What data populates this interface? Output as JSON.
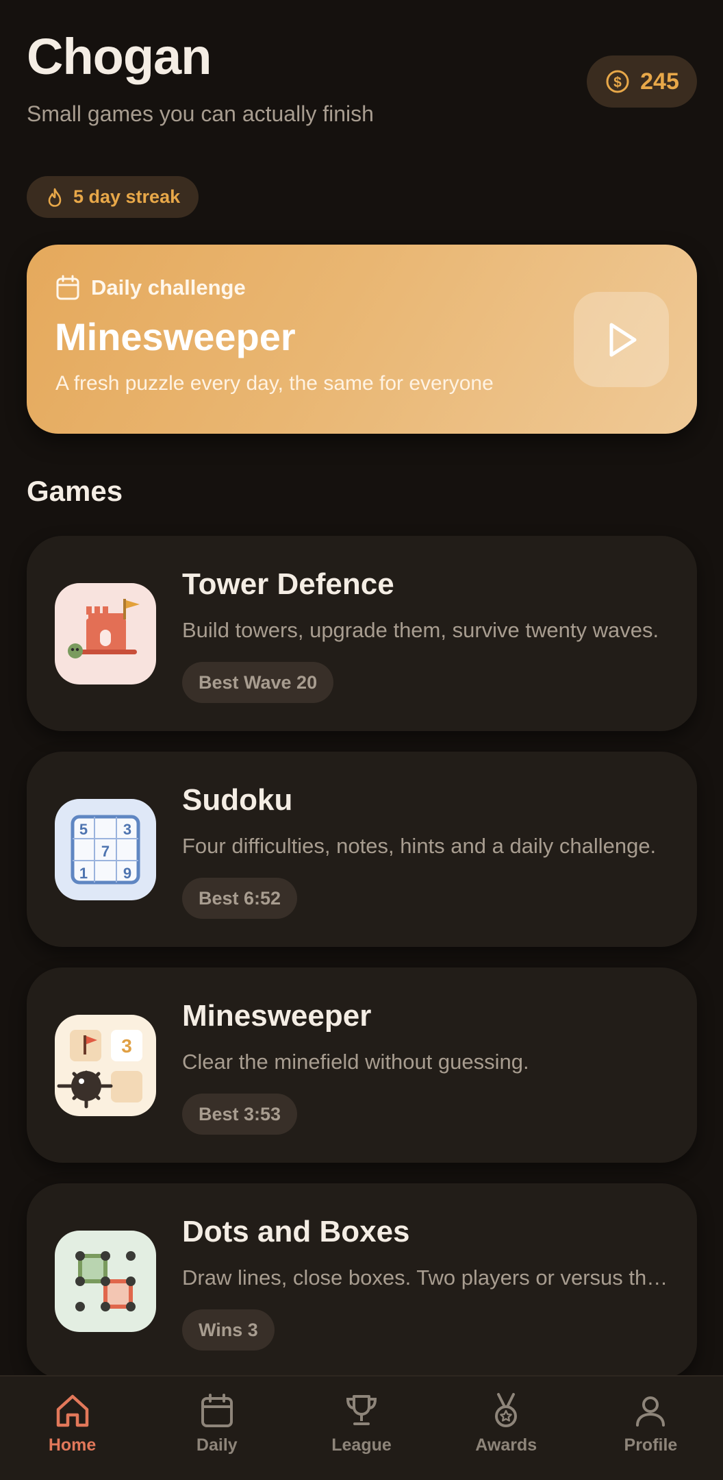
{
  "header": {
    "title": "Chogan",
    "subtitle": "Small games you can actually finish",
    "coins": "245",
    "streak": "5 day streak"
  },
  "daily": {
    "label": "Daily challenge",
    "game": "Minesweeper",
    "description": "A fresh puzzle every day, the same for everyone"
  },
  "games_heading": "Games",
  "games": [
    {
      "title": "Tower Defence",
      "description": "Build towers, upgrade them, survive twenty waves.",
      "badge": "Best Wave 20",
      "icon": "tower-icon"
    },
    {
      "title": "Sudoku",
      "description": "Four difficulties, notes, hints and a daily challenge.",
      "badge": "Best 6:52",
      "icon": "sudoku-icon"
    },
    {
      "title": "Minesweeper",
      "description": "Clear the minefield without guessing.",
      "badge": "Best 3:53",
      "icon": "mine-icon"
    },
    {
      "title": "Dots and Boxes",
      "description": "Draw lines, close boxes. Two players or versus the computer.",
      "badge": "Wins 3",
      "icon": "dots-icon"
    }
  ],
  "sudoku_digits": [
    "5",
    "3",
    "7",
    "1",
    "9"
  ],
  "mine_number": "3",
  "nav": [
    {
      "label": "Home",
      "icon": "home-icon",
      "active": true
    },
    {
      "label": "Daily",
      "icon": "calendar-icon",
      "active": false
    },
    {
      "label": "League",
      "icon": "trophy-icon",
      "active": false
    },
    {
      "label": "Awards",
      "icon": "medal-icon",
      "active": false
    },
    {
      "label": "Profile",
      "icon": "person-icon",
      "active": false
    }
  ],
  "colors": {
    "background": "#15110e",
    "card": "#221d18",
    "accent": "#e8a849",
    "active_nav": "#e2785a"
  }
}
